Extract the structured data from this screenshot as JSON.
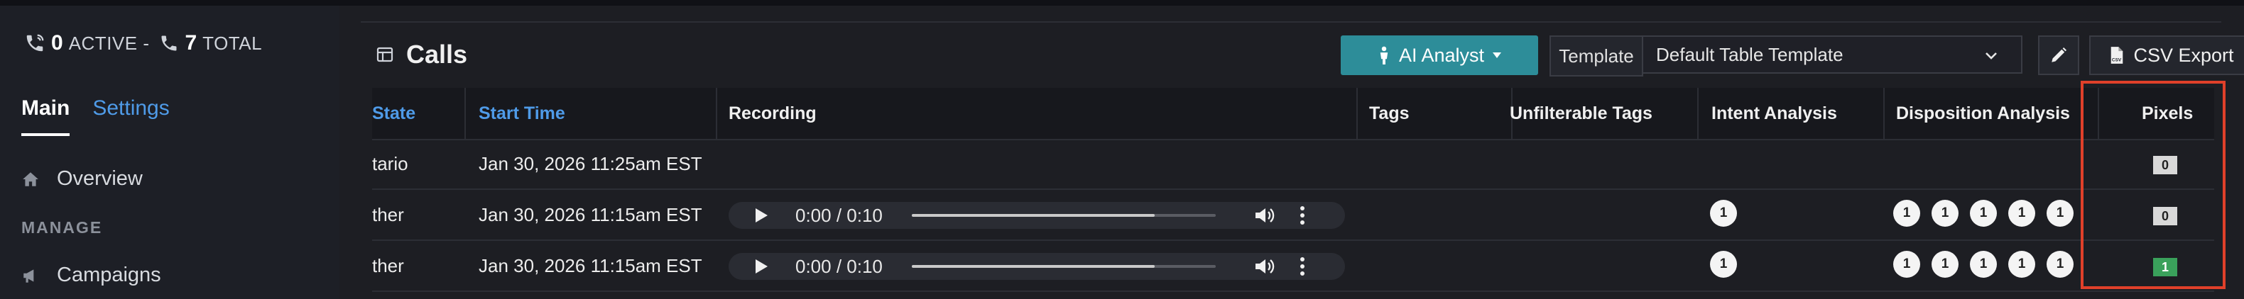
{
  "sidebar": {
    "status": {
      "active_count": "0",
      "active_label": "ACTIVE -",
      "total_count": "7",
      "total_label": "TOTAL"
    },
    "tabs": {
      "main": "Main",
      "settings": "Settings"
    },
    "nav": {
      "overview": "Overview",
      "section_manage": "MANAGE",
      "campaigns": "Campaigns"
    }
  },
  "header": {
    "title": "Calls",
    "ai_analyst_label": "AI Analyst",
    "template_label": "Template",
    "template_value": "Default Table Template",
    "csv_export_label": "CSV Export"
  },
  "table": {
    "columns": [
      "State",
      "Start Time",
      "Recording",
      "Tags",
      "Unfilterable Tags",
      "Intent Analysis",
      "Disposition Analysis",
      "Pixels"
    ],
    "rows": [
      {
        "state": "tario",
        "start_time": "Jan 30, 2026 11:25am EST",
        "recording": null,
        "intent": [],
        "disposition": [],
        "pixels": "0"
      },
      {
        "state": "ther",
        "start_time": "Jan 30, 2026 11:15am EST",
        "recording": {
          "time": "0:00 / 0:10",
          "progress": 0.8
        },
        "intent": [
          "1"
        ],
        "disposition": [
          "1",
          "1",
          "1",
          "1",
          "1"
        ],
        "pixels": "0"
      },
      {
        "state": "ther",
        "start_time": "Jan 30, 2026 11:15am EST",
        "recording": {
          "time": "0:00 / 0:10",
          "progress": 0.8
        },
        "intent": [
          "1"
        ],
        "disposition": [
          "1",
          "1",
          "1",
          "1",
          "1"
        ],
        "pixels": "1"
      }
    ]
  },
  "colors": {
    "accent_teal": "#2d8d99",
    "link_blue": "#4f9be8",
    "highlight_red": "#e0402a",
    "pixel_green": "#3aa15b"
  },
  "icons": [
    "phone-volume-icon",
    "phone-icon",
    "home-icon",
    "megaphone-icon",
    "table-icon",
    "person-icon",
    "caret-down-icon",
    "chevron-down-icon",
    "pencil-icon",
    "csv-file-icon",
    "play-icon",
    "volume-icon",
    "kebab-icon"
  ]
}
